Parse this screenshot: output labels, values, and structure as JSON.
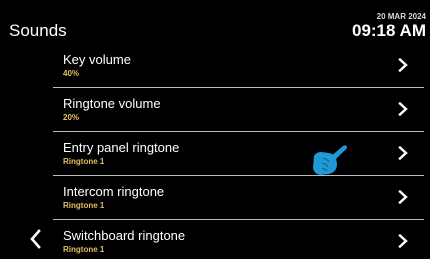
{
  "header": {
    "title": "Sounds",
    "date": "20 MAR 2024",
    "time": "09:18 AM"
  },
  "settings": [
    {
      "label": "Key volume",
      "value": "40%"
    },
    {
      "label": "Ringtone volume",
      "value": "20%"
    },
    {
      "label": "Entry panel ringtone",
      "value": "Ringtone 1"
    },
    {
      "label": "Intercom ringtone",
      "value": "Ringtone 1"
    },
    {
      "label": "Switchboard ringtone",
      "value": "Ringtone 1"
    }
  ],
  "colors": {
    "background": "#000000",
    "value_text": "#e0c060",
    "divider": "#bdbdbd",
    "hand_cursor": "#1f9ad6"
  },
  "icons": {
    "row_chevron": "chevron-right-icon",
    "back": "chevron-left-icon",
    "cursor": "pointing-hand-icon"
  }
}
